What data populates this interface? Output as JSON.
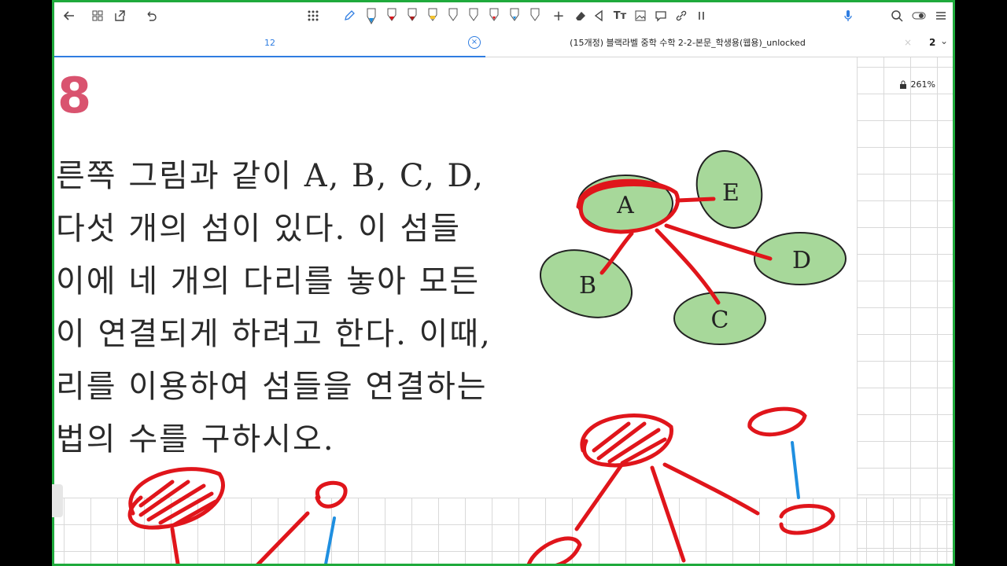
{
  "toolbar": {
    "back_icon": "arrow-left-icon",
    "grid_icon": "grid-icon",
    "export_icon": "export-icon",
    "undo_icon": "undo-icon",
    "apps_icon": "apps-dots-icon",
    "add_label": "+",
    "text_label": "Tт",
    "mic_icon": "microphone-icon",
    "search_icon": "search-icon",
    "toggle_icon": "toggle-icon",
    "menu_icon": "menu-icon"
  },
  "tabs": [
    {
      "label": "12",
      "active": true
    },
    {
      "label": "(15개정) 블랙라벨 중학 수학 2-2-본문_학생용(웹용)_unlocked",
      "active": false
    }
  ],
  "tab_count": "2",
  "zoom_label": "261%",
  "question": {
    "number": "8",
    "lines": [
      "른쪽 그림과 같이 A, B, C, D,",
      " 다섯 개의 섬이 있다. 이 섬들",
      "이에 네 개의 다리를 놓아 모든",
      "이 연결되게 하려고 한다. 이때,",
      "리를 이용하여 섬들을 연결하는",
      "법의 수를 구하시오."
    ]
  },
  "islands": [
    {
      "label": "A"
    },
    {
      "label": "E"
    },
    {
      "label": "D"
    },
    {
      "label": "B"
    },
    {
      "label": "C"
    }
  ],
  "colors": {
    "frame": "#1faa3c",
    "island_fill": "#a7d89a",
    "ink_red": "#e0151b",
    "ink_blue": "#1f8fe0",
    "accent_blue": "#2f7de1",
    "number_pink": "#d9536f"
  }
}
